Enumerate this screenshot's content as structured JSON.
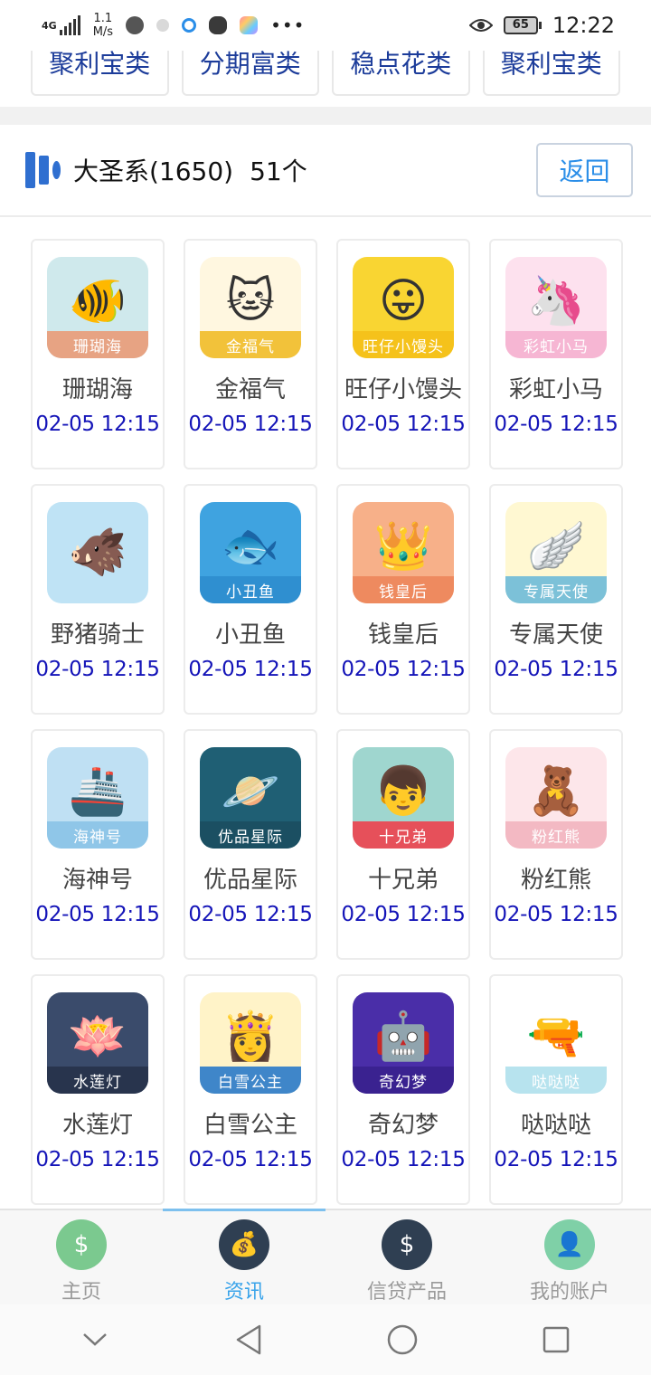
{
  "status_bar": {
    "network": "4G",
    "speed_value": "1.1",
    "speed_unit": "M/s",
    "battery": "65",
    "time": "12:22"
  },
  "categories": [
    "聚利宝类",
    "分期富类",
    "稳点花类",
    "聚利宝类"
  ],
  "header": {
    "title": "大圣系(1650)",
    "count": "51个",
    "back_label": "返回"
  },
  "apps": [
    {
      "name": "珊瑚海",
      "time": "02-05 12:15",
      "icon": "coral-sea-icon",
      "glyph": "🐠",
      "ribbon": "珊瑚海",
      "bg": "#cfe9ec",
      "ribbon_bg": "#e7a383"
    },
    {
      "name": "金福气",
      "time": "02-05 12:15",
      "icon": "lucky-cat-icon",
      "glyph": "🐱",
      "ribbon": "金福气",
      "bg": "#fff7e0",
      "ribbon_bg": "#f2c23a"
    },
    {
      "name": "旺仔小馒头",
      "time": "02-05 12:15",
      "icon": "wangzai-icon",
      "glyph": "😛",
      "ribbon": "旺仔小馒头",
      "bg": "#f9d532",
      "ribbon_bg": "#f5c21b"
    },
    {
      "name": "彩虹小马",
      "time": "02-05 12:15",
      "icon": "unicorn-icon",
      "glyph": "🦄",
      "ribbon": "彩虹小马",
      "bg": "#fde1ee",
      "ribbon_bg": "#f6b6d3"
    },
    {
      "name": "野猪骑士",
      "time": "02-05 12:15",
      "icon": "hog-rider-icon",
      "glyph": "🐗",
      "ribbon": "",
      "bg": "#bfe3f5",
      "ribbon_bg": "#6fb34a"
    },
    {
      "name": "小丑鱼",
      "time": "02-05 12:15",
      "icon": "clownfish-icon",
      "glyph": "🐟",
      "ribbon": "小丑鱼",
      "bg": "#3fa3e0",
      "ribbon_bg": "#2f8fd0"
    },
    {
      "name": "钱皇后",
      "time": "02-05 12:15",
      "icon": "crown-icon",
      "glyph": "👑",
      "ribbon": "钱皇后",
      "bg": "#f7b089",
      "ribbon_bg": "#ee8a5f"
    },
    {
      "name": "专属天使",
      "time": "02-05 12:15",
      "icon": "angel-wings-icon",
      "glyph": "🪽",
      "ribbon": "专属天使",
      "bg": "#fff8d2",
      "ribbon_bg": "#7cc1d8"
    },
    {
      "name": "海神号",
      "time": "02-05 12:15",
      "icon": "cruise-ship-icon",
      "glyph": "🚢",
      "ribbon": "海神号",
      "bg": "#bfe0f3",
      "ribbon_bg": "#8fc6e8"
    },
    {
      "name": "优品星际",
      "time": "02-05 12:15",
      "icon": "planet-icon",
      "glyph": "🪐",
      "ribbon": "优品星际",
      "bg": "#1f5f74",
      "ribbon_bg": "#1b4f62"
    },
    {
      "name": "十兄弟",
      "time": "02-05 12:15",
      "icon": "brothers-icon",
      "glyph": "👦",
      "ribbon": "十兄弟",
      "bg": "#9fd6cf",
      "ribbon_bg": "#e6505a"
    },
    {
      "name": "粉红熊",
      "time": "02-05 12:15",
      "icon": "pink-bear-icon",
      "glyph": "🧸",
      "ribbon": "粉红熊",
      "bg": "#fde6ea",
      "ribbon_bg": "#f3b9c3"
    },
    {
      "name": "水莲灯",
      "time": "02-05 12:15",
      "icon": "lotus-lamp-icon",
      "glyph": "🪷",
      "ribbon": "水莲灯",
      "bg": "#3a4b6b",
      "ribbon_bg": "#28344d"
    },
    {
      "name": "白雪公主",
      "time": "02-05 12:15",
      "icon": "snow-white-icon",
      "glyph": "👸",
      "ribbon": "白雪公主",
      "bg": "#fff3c8",
      "ribbon_bg": "#3f86c9"
    },
    {
      "name": "奇幻梦",
      "time": "02-05 12:15",
      "icon": "robot-icon",
      "glyph": "🤖",
      "ribbon": "奇幻梦",
      "bg": "#4a2ea8",
      "ribbon_bg": "#3a2290"
    },
    {
      "name": "哒哒哒",
      "time": "02-05 12:15",
      "icon": "water-gun-boy-icon",
      "glyph": "🔫",
      "ribbon": "哒哒哒",
      "bg": "#ffffff",
      "ribbon_bg": "#b7e3ee"
    }
  ],
  "bottom_nav": [
    {
      "label": "主页",
      "icon": "home-icon",
      "glyph": "$",
      "bg": "#7bc98f",
      "active": false
    },
    {
      "label": "资讯",
      "icon": "money-bag-icon",
      "glyph": "💰",
      "bg": "#2f3f52",
      "active": true
    },
    {
      "label": "信贷产品",
      "icon": "money-sack-icon",
      "glyph": "$",
      "bg": "#2f3f52",
      "active": false
    },
    {
      "label": "我的账户",
      "icon": "user-avatar-icon",
      "glyph": "👤",
      "bg": "#7fd0a7",
      "active": false
    }
  ]
}
